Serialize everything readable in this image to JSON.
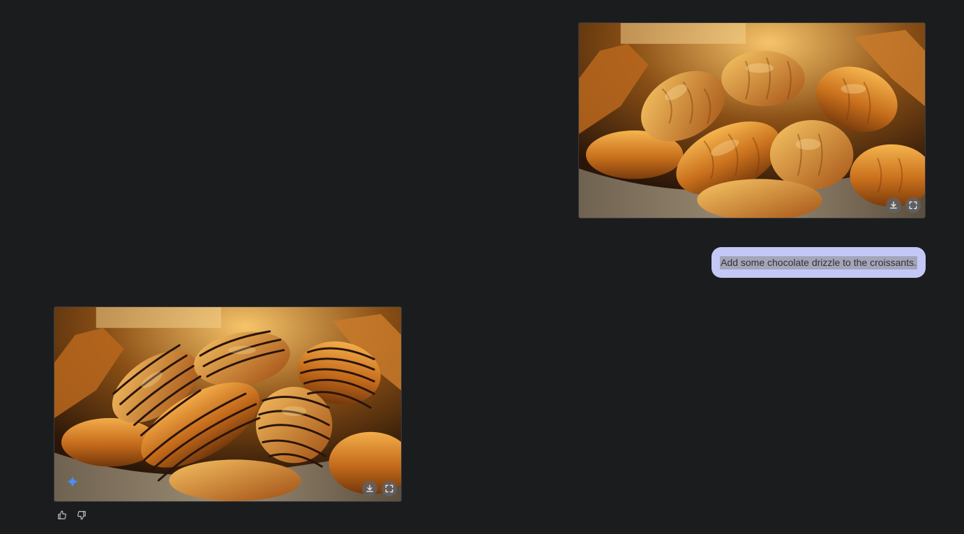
{
  "conversation": {
    "user_image": {
      "alt": "Croissants in a basket",
      "download_icon": "download-icon",
      "fullscreen_icon": "fullscreen-icon"
    },
    "prompt": {
      "text": "Add some chocolate drizzle to the croissants."
    },
    "ai_image": {
      "alt": "Croissants with chocolate drizzle",
      "badge_icon": "sparkle-icon",
      "download_icon": "download-icon",
      "fullscreen_icon": "fullscreen-icon"
    },
    "feedback": {
      "like_icon": "thumbs-up-icon",
      "dislike_icon": "thumbs-down-icon"
    }
  },
  "colors": {
    "background": "#1b1c1e",
    "bubble": "#c4c8f6",
    "selection": "#a3a6b9",
    "sparkle": "#4b8ef5"
  }
}
